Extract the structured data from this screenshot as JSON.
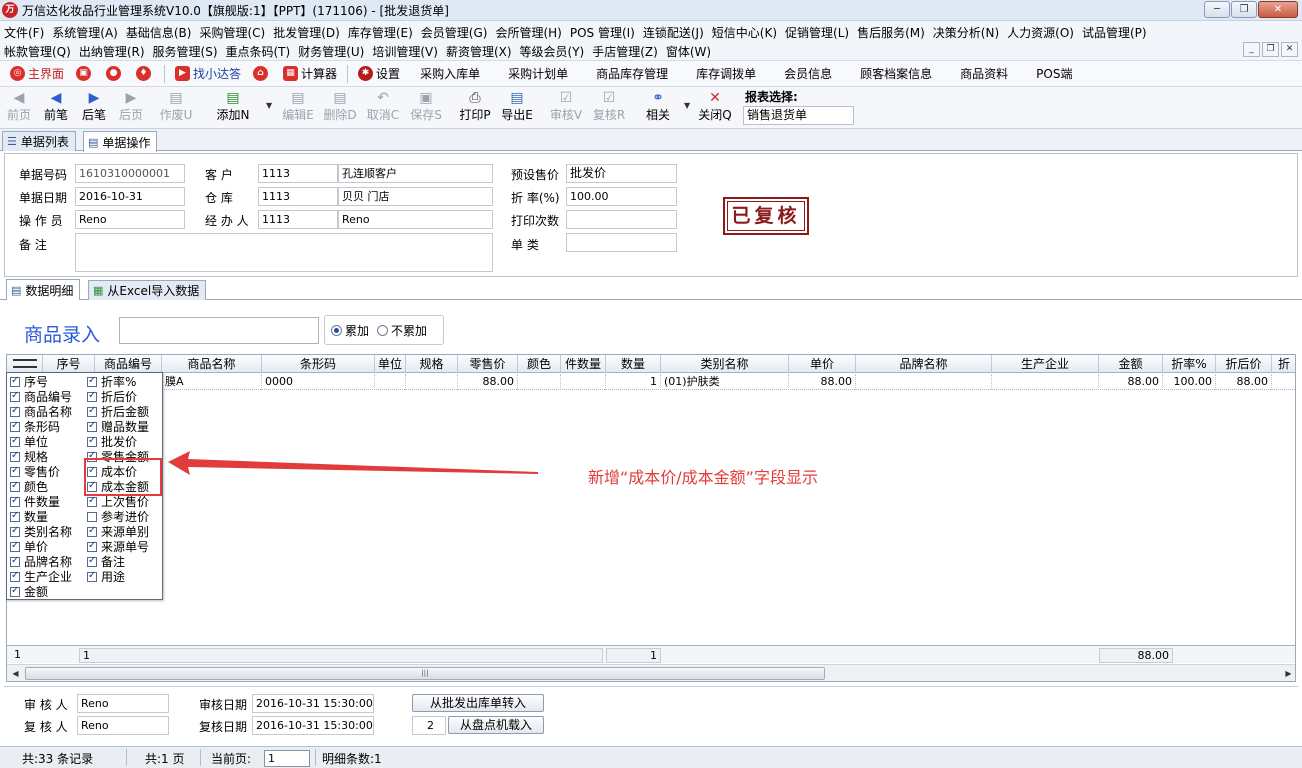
{
  "window": {
    "title": "万信达化妆品行业管理系统V10.0【旗舰版:1】【PPT】(171106) - [批发退货单]"
  },
  "menu": {
    "row1": [
      "文件(F)",
      "系统管理(A)",
      "基础信息(B)",
      "采购管理(C)",
      "批发管理(D)",
      "库存管理(E)",
      "会员管理(G)",
      "会所管理(H)",
      "POS 管理(I)",
      "连锁配送(J)",
      "短信中心(K)",
      "促销管理(L)",
      "售后服务(M)",
      "决策分析(N)",
      "人力资源(O)",
      "试品管理(P)"
    ],
    "row2": [
      "帐款管理(Q)",
      "出纳管理(R)",
      "服务管理(S)",
      "重点条码(T)",
      "财务管理(U)",
      "培训管理(V)",
      "薪资管理(X)",
      "等级会员(Y)",
      "手店管理(Z)",
      "窗体(W)"
    ]
  },
  "quickbar": {
    "home": "主界面",
    "find": "找小达答",
    "calc": "计算器",
    "settings": "设置",
    "links": [
      "采购入库单",
      "采购计划单",
      "商品库存管理",
      "库存调拨单",
      "会员信息",
      "顾客档案信息",
      "商品资料",
      "POS端"
    ]
  },
  "toolbar": {
    "first": "前页",
    "prev": "前笔",
    "next": "后笔",
    "last": "后页",
    "void": "作废U",
    "add": "添加N",
    "edit": "编辑E",
    "delete": "删除D",
    "cancel": "取消C",
    "save": "保存S",
    "print": "打印P",
    "export": "导出E",
    "review": "审核V",
    "recheck": "复核R",
    "related": "相关",
    "close": "关闭Q",
    "report_label": "报表选择:",
    "report_value": "销售退货单"
  },
  "tabs": {
    "list": "单据列表",
    "operate": "单据操作"
  },
  "form": {
    "doc_no_label": "单据号码",
    "doc_no": "1610310000001",
    "doc_date_label": "单据日期",
    "doc_date": "2016-10-31",
    "operator_label": "操 作 员",
    "operator": "Reno",
    "remark_label": "备    注",
    "remark": "",
    "customer_label": "客    户",
    "customer_code": "1113",
    "customer_name": "孔连顺客户",
    "warehouse_label": "仓    库",
    "warehouse_code": "1113",
    "warehouse_name": "贝贝 门店",
    "handler_label": "经 办 人",
    "handler_code": "1113",
    "handler_name": "Reno",
    "preset_price_label": "预设售价",
    "preset_price": "批发价",
    "discount_label": "折  率(%)",
    "discount": "100.00",
    "print_count_label": "打印次数",
    "print_count": "",
    "doc_type_label": "单    类",
    "doc_type": "",
    "stamp": "已复核"
  },
  "detail_tabs": {
    "detail": "数据明细",
    "excel": "从Excel导入数据"
  },
  "entry": {
    "title": "商品录入",
    "accumulate": "累加",
    "no_accumulate": "不累加"
  },
  "grid": {
    "headers": [
      "序号",
      "商品编号",
      "商品名称",
      "条形码",
      "单位",
      "规格",
      "零售价",
      "颜色",
      "件数量",
      "数量",
      "类别名称",
      "单价",
      "品牌名称",
      "生产企业",
      "金额",
      "折率%",
      "折后价",
      "折"
    ],
    "row": {
      "name_tail": "膜A",
      "barcode": "0000",
      "retail_price": "88.00",
      "quantity": "1",
      "category": "(01)护肤类",
      "unit_price": "88.00",
      "amount": "88.00",
      "discount_rate": "100.00",
      "discounted_price": "88.00"
    },
    "footer": {
      "row_count": "1",
      "code_count": "1",
      "quantity_total": "1",
      "amount_total": "88.00"
    }
  },
  "column_chooser": {
    "left": [
      {
        "label": "序号",
        "checked": true
      },
      {
        "label": "商品编号",
        "checked": true
      },
      {
        "label": "商品名称",
        "checked": true
      },
      {
        "label": "条形码",
        "checked": true
      },
      {
        "label": "单位",
        "checked": true
      },
      {
        "label": "规格",
        "checked": true
      },
      {
        "label": "零售价",
        "checked": true
      },
      {
        "label": "颜色",
        "checked": true
      },
      {
        "label": "件数量",
        "checked": true
      },
      {
        "label": "数量",
        "checked": true
      },
      {
        "label": "类别名称",
        "checked": true
      },
      {
        "label": "单价",
        "checked": true
      },
      {
        "label": "品牌名称",
        "checked": true
      },
      {
        "label": "生产企业",
        "checked": true
      },
      {
        "label": "金额",
        "checked": true
      }
    ],
    "right": [
      {
        "label": "折率%",
        "checked": true
      },
      {
        "label": "折后价",
        "checked": true
      },
      {
        "label": "折后金额",
        "checked": true
      },
      {
        "label": "赠品数量",
        "checked": true
      },
      {
        "label": "批发价",
        "checked": true
      },
      {
        "label": "零售金额",
        "checked": true
      },
      {
        "label": "成本价",
        "checked": true
      },
      {
        "label": "成本金额",
        "checked": true
      },
      {
        "label": "上次售价",
        "checked": true
      },
      {
        "label": "参考进价",
        "checked": false
      },
      {
        "label": "来源单别",
        "checked": true
      },
      {
        "label": "来源单号",
        "checked": true
      },
      {
        "label": "备注",
        "checked": true
      },
      {
        "label": "用途",
        "checked": true
      }
    ]
  },
  "annotation": "新增“成本价/成本金额”字段显示",
  "bottom": {
    "reviewer_label": "审 核 人",
    "reviewer": "Reno",
    "rechecker_label": "复 核 人",
    "rechecker": "Reno",
    "review_date_label": "审核日期",
    "review_date": "2016-10-31 15:30:00",
    "recheck_date_label": "复核日期",
    "recheck_date": "2016-10-31 15:30:00",
    "btn_transfer": "从批发出库单转入",
    "machine_no": "2",
    "btn_load": "从盘点机载入"
  },
  "status": {
    "records": "共:33 条记录",
    "pages": "共:1 页",
    "current_label": "当前页:",
    "current_page": "1",
    "detail_count": "明细条数:1"
  },
  "colors": {
    "accent_red": "#e23b3b",
    "stamp": "#8b1a1a",
    "entry_blue": "#2a5bd6"
  }
}
